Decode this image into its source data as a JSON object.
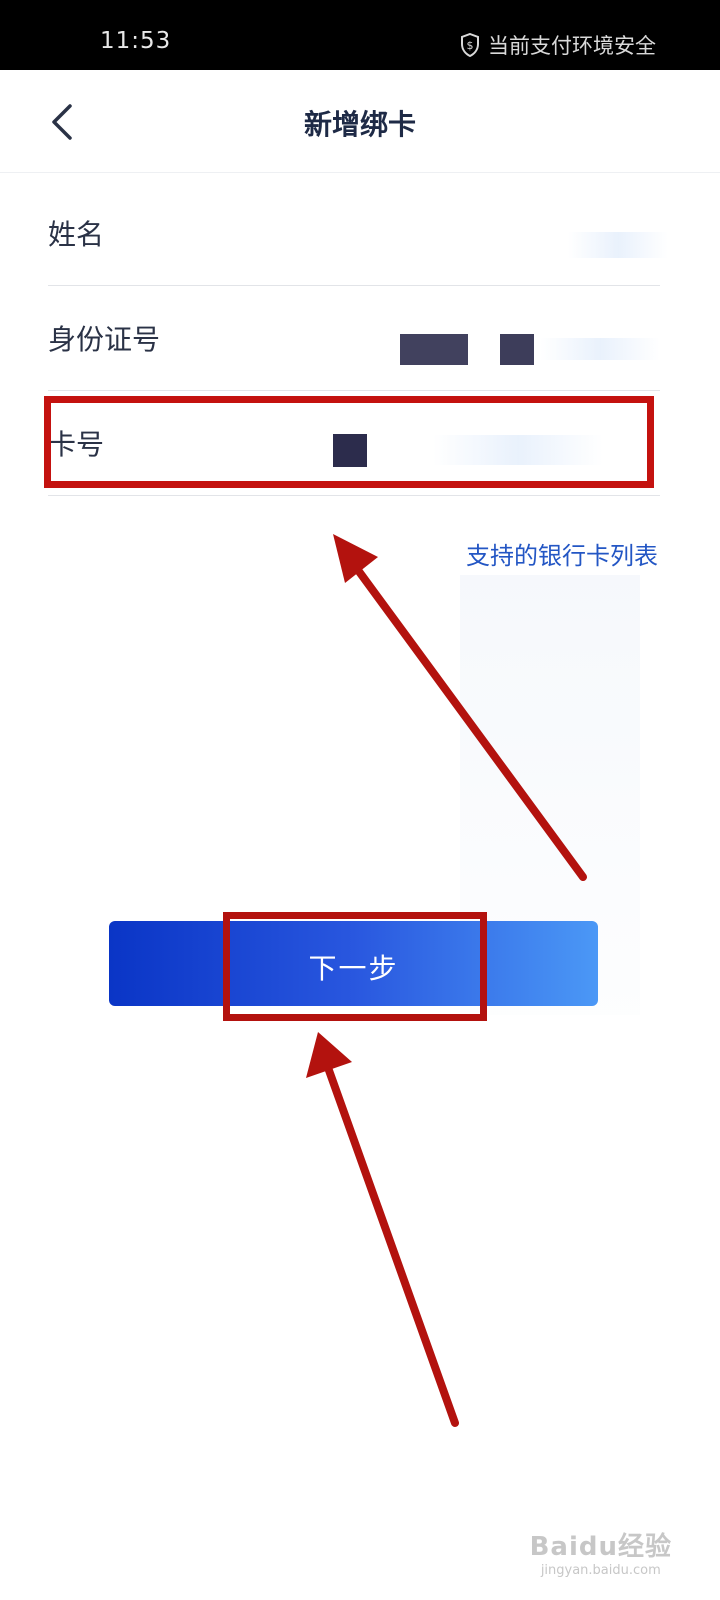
{
  "status_bar": {
    "time": "11:53",
    "security_text": "当前支付环境安全",
    "security_icon": "shield-dollar-icon"
  },
  "nav": {
    "title": "新增绑卡",
    "back_icon": "chevron-left-icon"
  },
  "form": {
    "name_label": "姓名",
    "id_label": "身份证号",
    "card_label": "卡号"
  },
  "support_link": "支持的银行卡列表",
  "next_button": "下一步",
  "watermark": {
    "brand": "Baidu经验",
    "url": "jingyan.baidu.com"
  },
  "colors": {
    "annotation_red": "#c4120f",
    "button_start": "#0a35c6",
    "button_end": "#4b98f6",
    "link_blue": "#2356c4"
  }
}
